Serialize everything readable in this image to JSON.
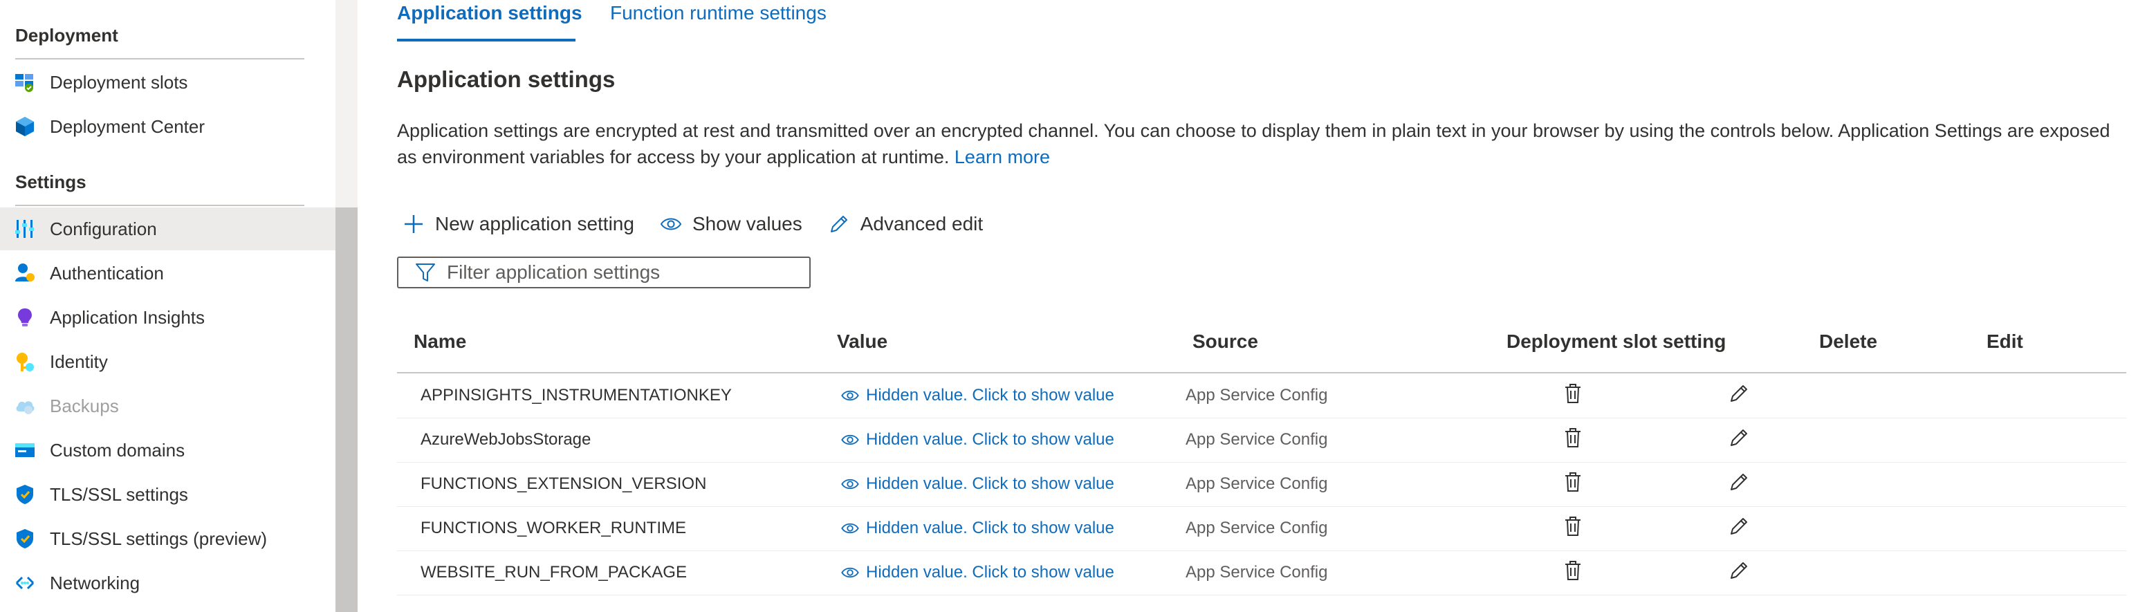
{
  "sidebar": {
    "sections": [
      {
        "header": "Deployment",
        "items": [
          {
            "label": "Deployment slots",
            "icon": "deployment-slots-icon"
          },
          {
            "label": "Deployment Center",
            "icon": "deployment-center-icon"
          }
        ]
      },
      {
        "header": "Settings",
        "items": [
          {
            "label": "Configuration",
            "icon": "configuration-icon",
            "selected": true
          },
          {
            "label": "Authentication",
            "icon": "authentication-icon"
          },
          {
            "label": "Application Insights",
            "icon": "application-insights-icon"
          },
          {
            "label": "Identity",
            "icon": "identity-icon"
          },
          {
            "label": "Backups",
            "icon": "backups-icon",
            "disabled": true
          },
          {
            "label": "Custom domains",
            "icon": "custom-domains-icon"
          },
          {
            "label": "TLS/SSL settings",
            "icon": "tls-shield-icon"
          },
          {
            "label": "TLS/SSL settings (preview)",
            "icon": "tls-shield-icon"
          },
          {
            "label": "Networking",
            "icon": "networking-icon"
          }
        ]
      }
    ]
  },
  "tabs": [
    {
      "label": "Application settings",
      "active": true
    },
    {
      "label": "Function runtime settings",
      "active": false
    }
  ],
  "section": {
    "title": "Application settings",
    "description": "Application settings are encrypted at rest and transmitted over an encrypted channel. You can choose to display them in plain text in your browser by using the controls below. Application Settings are exposed as environment variables for access by your application at runtime.",
    "learn_more": "Learn more"
  },
  "toolbar": {
    "new_setting": "New application setting",
    "show_values": "Show values",
    "advanced_edit": "Advanced edit"
  },
  "filter": {
    "placeholder": "Filter application settings"
  },
  "table": {
    "headers": {
      "name": "Name",
      "value": "Value",
      "source": "Source",
      "slot": "Deployment slot setting",
      "delete": "Delete",
      "edit": "Edit"
    },
    "rows": [
      {
        "name": "APPINSIGHTS_INSTRUMENTATIONKEY",
        "value": "Hidden value. Click to show value",
        "source": "App Service Config"
      },
      {
        "name": "AzureWebJobsStorage",
        "value": "Hidden value. Click to show value",
        "source": "App Service Config"
      },
      {
        "name": "FUNCTIONS_EXTENSION_VERSION",
        "value": "Hidden value. Click to show value",
        "source": "App Service Config"
      },
      {
        "name": "FUNCTIONS_WORKER_RUNTIME",
        "value": "Hidden value. Click to show value",
        "source": "App Service Config"
      },
      {
        "name": "WEBSITE_RUN_FROM_PACKAGE",
        "value": "Hidden value. Click to show value",
        "source": "App Service Config"
      }
    ]
  },
  "colors": {
    "accent": "#0f6cbd",
    "selected_bg": "#edebe9",
    "text": "#323130"
  }
}
